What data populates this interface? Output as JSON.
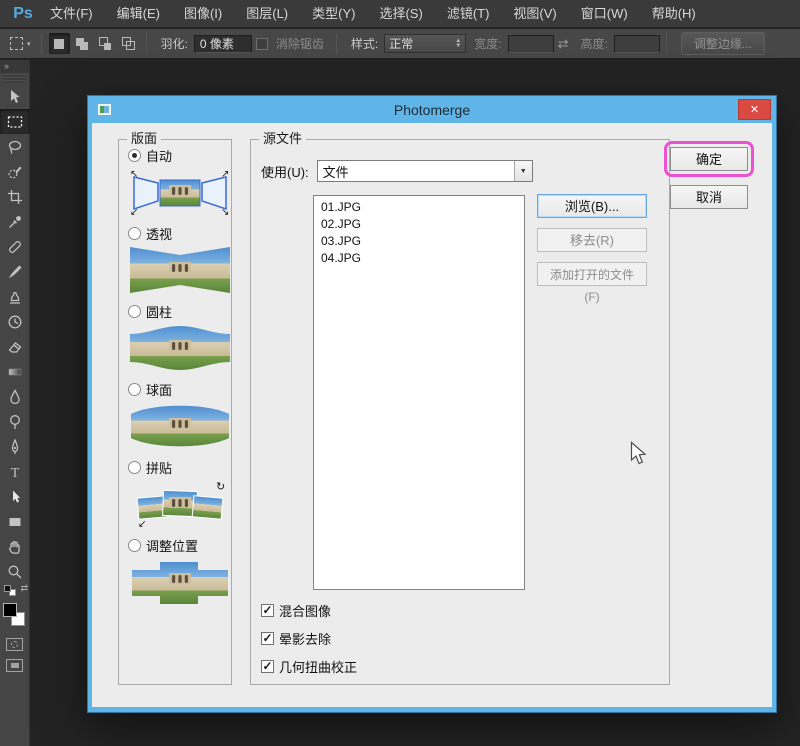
{
  "menu_bar": {
    "logo": "Ps",
    "items": [
      "文件(F)",
      "编辑(E)",
      "图像(I)",
      "图层(L)",
      "类型(Y)",
      "选择(S)",
      "滤镜(T)",
      "视图(V)",
      "窗口(W)",
      "帮助(H)"
    ]
  },
  "options_bar": {
    "feather_label": "羽化:",
    "feather_value": "0 像素",
    "antialias_label": "消除锯齿",
    "style_label": "样式:",
    "style_value": "正常",
    "width_label": "宽度:",
    "width_value": "",
    "height_label": "高度:",
    "height_value": "",
    "refine_edge_label": "调整边缘..."
  },
  "dialog": {
    "title": "Photomerge",
    "layout_group": {
      "label": "版面",
      "options": [
        {
          "label": "自动",
          "selected": true
        },
        {
          "label": "透视",
          "selected": false
        },
        {
          "label": "圆柱",
          "selected": false
        },
        {
          "label": "球面",
          "selected": false
        },
        {
          "label": "拼贴",
          "selected": false
        },
        {
          "label": "调整位置",
          "selected": false
        }
      ]
    },
    "source_group": {
      "label": "源文件",
      "use_label": "使用(U):",
      "use_value": "文件",
      "files": [
        "01.JPG",
        "02.JPG",
        "03.JPG",
        "04.JPG"
      ],
      "browse_label": "浏览(B)...",
      "remove_label": "移去(R)",
      "add_open_label": "添加打开的文件(F)",
      "checkboxes": [
        {
          "label": "混合图像",
          "checked": true
        },
        {
          "label": "晕影去除",
          "checked": true
        },
        {
          "label": "几何扭曲校正",
          "checked": true
        }
      ]
    },
    "ok_label": "确定",
    "cancel_label": "取消"
  },
  "icons": {
    "close": "✕",
    "collapse": "»",
    "swap": "⇄",
    "dropdown": "▼",
    "spin_up": "▲",
    "spin_down": "▼",
    "check": "✓",
    "caret": "▾"
  },
  "colors": {
    "titlebar_blue": "#5FB5E8",
    "highlight_pink": "#EE50D2",
    "close_red": "#DB4A42",
    "focus_blue": "#66A7E0"
  }
}
